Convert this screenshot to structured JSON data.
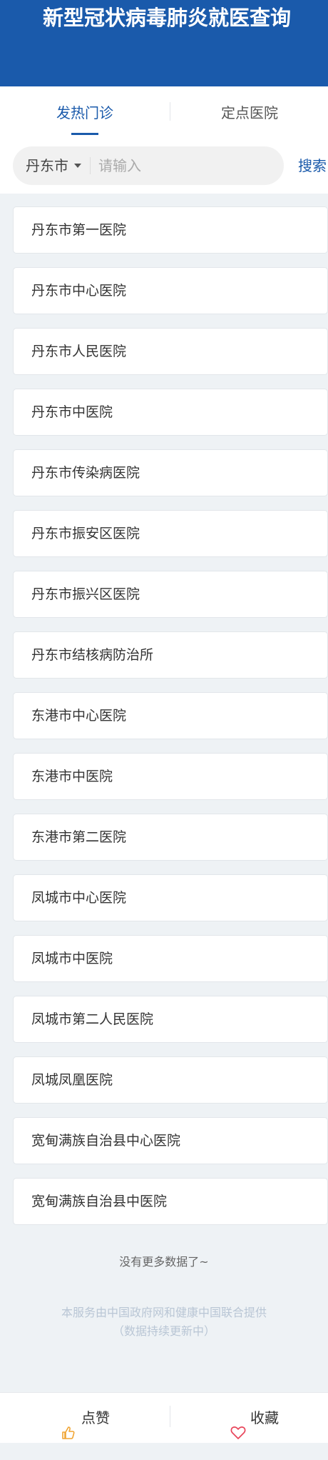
{
  "header": {
    "title": "新型冠状病毒肺炎就医查询"
  },
  "tabs": [
    {
      "label": "发热门诊"
    },
    {
      "label": "定点医院"
    }
  ],
  "search": {
    "city": "丹东市",
    "placeholder": "请输入",
    "value": "",
    "button_label": "搜索"
  },
  "hospitals": [
    "丹东市第一医院",
    "丹东市中心医院",
    "丹东市人民医院",
    "丹东市中医院",
    "丹东市传染病医院",
    "丹东市振安区医院",
    "丹东市振兴区医院",
    "丹东市结核病防治所",
    "东港市中心医院",
    "东港市中医院",
    "东港市第二医院",
    "凤城市中心医院",
    "凤城市中医院",
    "凤城市第二人民医院",
    "凤城凤凰医院",
    "宽甸满族自治县中心医院",
    "宽甸满族自治县中医院"
  ],
  "list_footer": "没有更多数据了~",
  "footer_note": {
    "line1": "本服务由中国政府网和健康中国联合提供",
    "line2": "（数据持续更新中）"
  },
  "bottom_bar": {
    "like_label": "点赞",
    "like_icon": "thumbs-up-icon",
    "favorite_label": "收藏",
    "favorite_icon": "heart-icon"
  },
  "colors": {
    "brand_blue": "#1a5aab",
    "like_icon": "#f0a431",
    "heart_icon": "#e8455a",
    "background": "#eef2f5"
  }
}
